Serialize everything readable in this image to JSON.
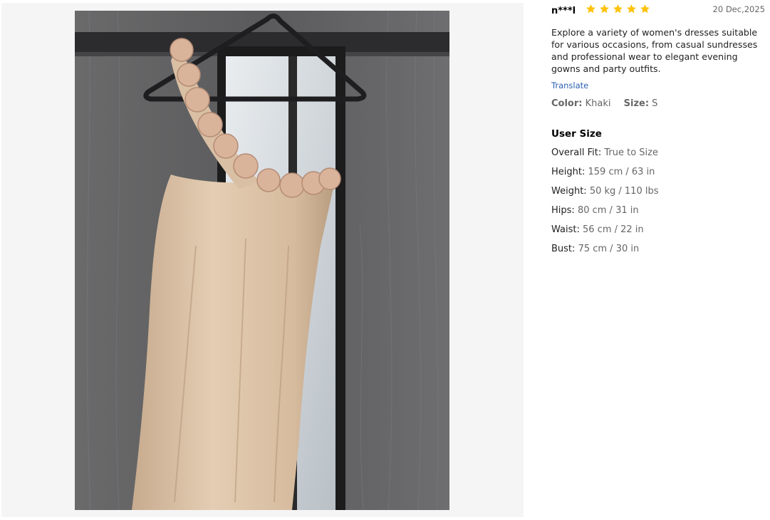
{
  "photo": {
    "alt": "khaki one-shoulder ruffle dress on hanger"
  },
  "review": {
    "user": "n***l",
    "rating": 5,
    "rating_max": 5,
    "star_color": "#ffc30f",
    "date": "20 Dec,2025",
    "text": "Explore a variety of women's dresses suitable for various occasions, from casual sundresses and professional wear to elegant evening gowns and party outfits.",
    "translate_label": "Translate",
    "color_label": "Color:",
    "color_value": "Khaki",
    "size_label": "Size:",
    "size_value": "S"
  },
  "user_size": {
    "title": "User Size",
    "rows": [
      {
        "label": "Overall Fit:",
        "value": "True to Size"
      },
      {
        "label": "Height:",
        "value": "159 cm / 63 in"
      },
      {
        "label": "Weight:",
        "value": "50 kg / 110 lbs"
      },
      {
        "label": "Hips:",
        "value": "80 cm / 31 in"
      },
      {
        "label": "Waist:",
        "value": "56 cm / 22 in"
      },
      {
        "label": "Bust:",
        "value": "75 cm / 30 in"
      }
    ]
  }
}
